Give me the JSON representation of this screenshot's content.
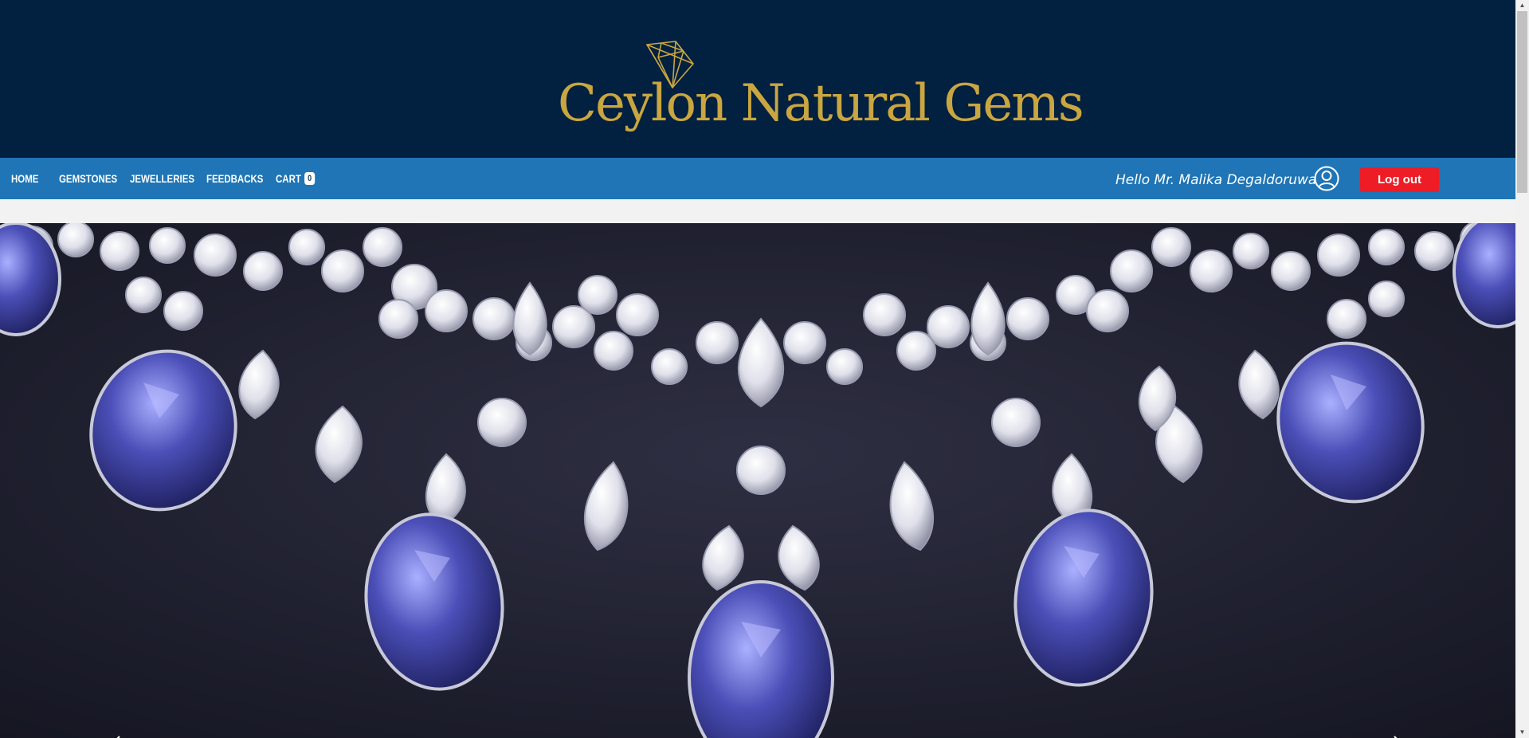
{
  "brand": {
    "name": "Ceylon Natural Gems",
    "logo_color": "#c9a640",
    "header_bg": "#02203f"
  },
  "nav": {
    "bg": "#1f75b5",
    "items": [
      {
        "label": "HOME"
      },
      {
        "label": "GEMSTONES"
      },
      {
        "label": "JEWELLERIES"
      },
      {
        "label": "FEEDBACKS"
      },
      {
        "label": "CART"
      }
    ],
    "cart_count": "0"
  },
  "user": {
    "greeting": "Hello Mr. Malika Degaldoruwa",
    "icon": "user-circle-icon",
    "logout_label": "Log out",
    "logout_color": "#ee1c25"
  },
  "hero": {
    "subject": "diamond and sapphire necklace",
    "prev_icon": "chevron-left-icon",
    "next_icon": "chevron-right-icon"
  },
  "scrollbar": {
    "up_glyph": "▲",
    "down_glyph": "▼"
  }
}
